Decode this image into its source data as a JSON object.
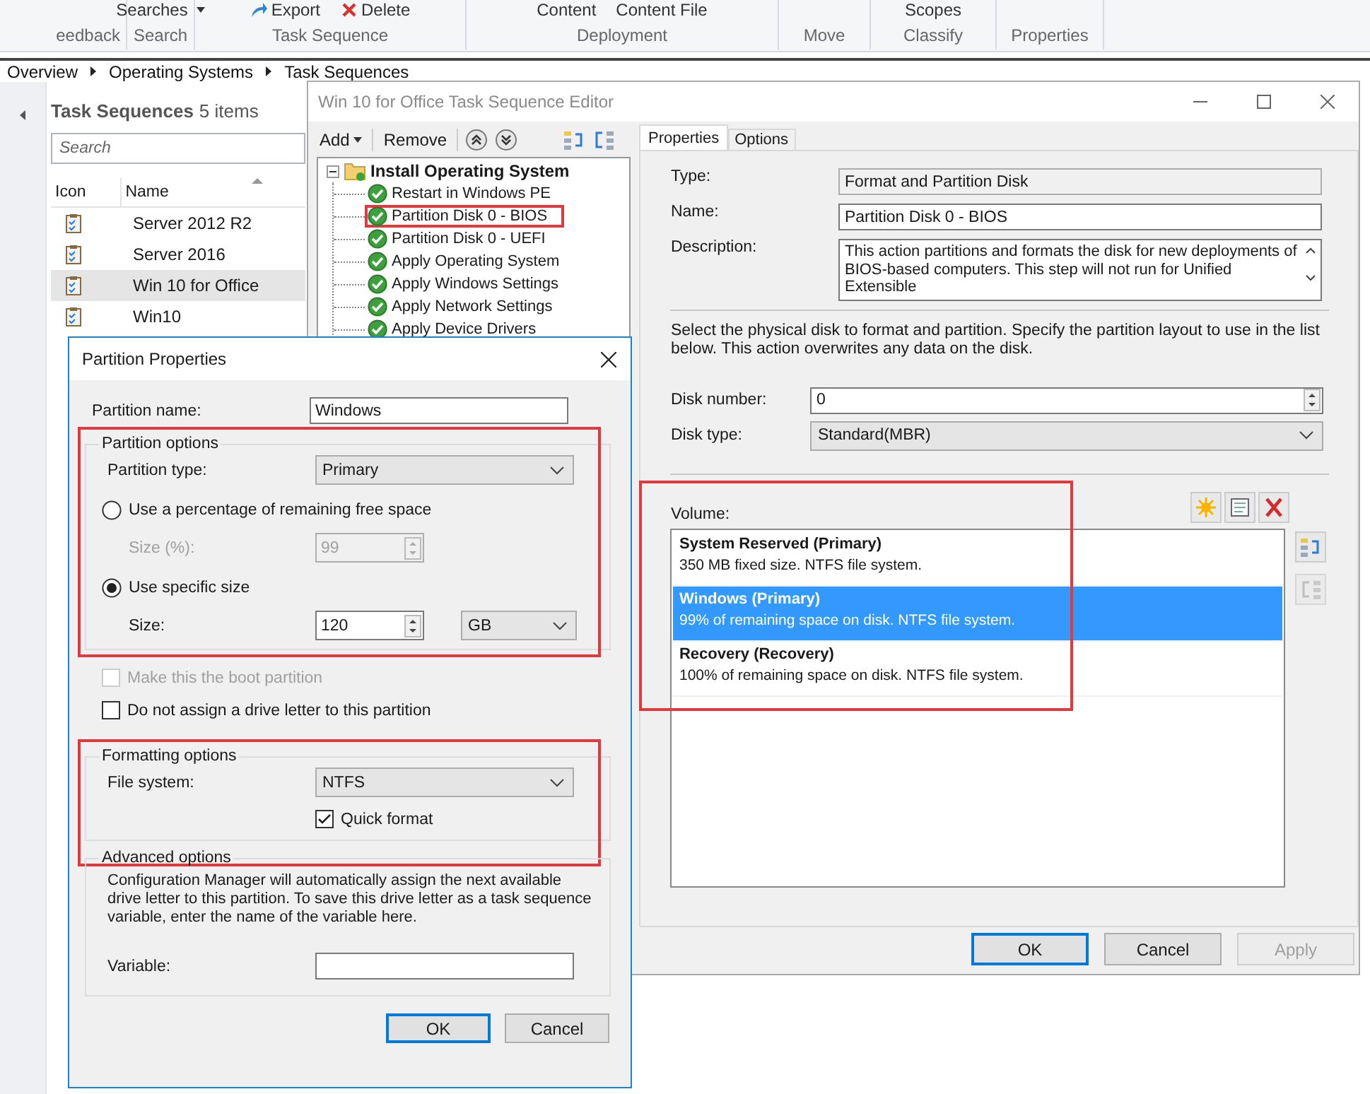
{
  "ribbon": {
    "groups": [
      {
        "label": "eedback"
      },
      {
        "label": "Search",
        "items": [
          {
            "label": "Searches",
            "kind": "dropdown"
          }
        ]
      },
      {
        "label": "Task Sequence",
        "items": [
          {
            "label": "Export",
            "kind": "export"
          },
          {
            "label": "Delete",
            "kind": "delete"
          }
        ]
      },
      {
        "label": "Deployment",
        "items": [
          {
            "label": "Content",
            "kind": "plain"
          },
          {
            "label": "Content File",
            "kind": "plain"
          }
        ]
      },
      {
        "label": "Move"
      },
      {
        "label": "Classify",
        "items": [
          {
            "label": "Scopes",
            "kind": "plain"
          }
        ]
      },
      {
        "label": "Properties"
      }
    ]
  },
  "breadcrumb": [
    "Overview",
    "Operating Systems",
    "Task Sequences"
  ],
  "console": {
    "title": "Task Sequences",
    "count": "5 items",
    "search": {
      "placeholder": "Search"
    },
    "columns": [
      {
        "label": "Icon"
      },
      {
        "label": "Name",
        "sorted": true
      }
    ],
    "rows": [
      {
        "name": "Server 2012 R2",
        "selected": false
      },
      {
        "name": "Server 2016",
        "selected": false
      },
      {
        "name": "Win 10 for Office",
        "selected": true
      },
      {
        "name": "Win10",
        "selected": false
      }
    ]
  },
  "editor": {
    "title": "Win 10 for Office Task Sequence Editor",
    "toolbar": [
      {
        "label": "Add",
        "kind": "dropdown"
      },
      {
        "label": "Remove",
        "kind": "plain"
      }
    ],
    "tree": {
      "label": "Install Operating System",
      "expanded": true,
      "children": [
        {
          "label": "Restart in Windows PE",
          "annotated": false
        },
        {
          "label": "Partition Disk 0 - BIOS",
          "annotated": true
        },
        {
          "label": "Partition Disk 0 - UEFI",
          "annotated": false
        },
        {
          "label": "Apply Operating System",
          "annotated": false
        },
        {
          "label": "Apply Windows Settings",
          "annotated": false
        },
        {
          "label": "Apply Network Settings",
          "annotated": false
        },
        {
          "label": "Apply Device Drivers",
          "annotated": false
        }
      ]
    },
    "tabs": [
      {
        "label": "Properties",
        "selected": true
      },
      {
        "label": "Options",
        "selected": false
      }
    ],
    "fields": [
      {
        "label": "Type:",
        "value": "Format and Partition Disk",
        "kind": "readonly"
      },
      {
        "label": "Name:",
        "value": "Partition Disk 0 - BIOS",
        "kind": "text"
      },
      {
        "label": "Description:",
        "value": "This action partitions and formats the disk for new deployments of BIOS-based computers. This step will not run for Unified Extensible",
        "kind": "multiline"
      }
    ],
    "instructions": "Select the physical disk to format and partition. Specify the partition layout to use in the list below. This action overwrites any data on the disk.",
    "disk_fields": [
      {
        "label": "Disk number:",
        "value": "0",
        "kind": "spin"
      },
      {
        "label": "Disk type:",
        "value": "Standard(MBR)",
        "kind": "dropdown"
      }
    ],
    "volume_label": "Volume:",
    "volumes_annotated": true,
    "volumes": [
      {
        "title": "System Reserved (Primary)",
        "detail": "350 MB fixed size. NTFS file system.",
        "selected": false
      },
      {
        "title": "Windows (Primary)",
        "detail": "99% of remaining space on disk. NTFS file system.",
        "selected": true
      },
      {
        "title": "Recovery (Recovery)",
        "detail": "100% of remaining space on disk. NTFS file system.",
        "selected": false
      }
    ],
    "buttons": [
      {
        "label": "OK",
        "default": true,
        "disabled": false
      },
      {
        "label": "Cancel",
        "default": false,
        "disabled": false
      },
      {
        "label": "Apply",
        "default": false,
        "disabled": true
      }
    ]
  },
  "dialog": {
    "title": "Partition Properties",
    "name_field": {
      "label": "Partition name:",
      "value": "Windows"
    },
    "partition_options": {
      "legend": "Partition options",
      "annotated": true,
      "type_field": {
        "label": "Partition type:",
        "value": "Primary"
      },
      "options": [
        {
          "label": "Use a percentage of remaining free space",
          "selected": false,
          "field": {
            "label": "Size (%):",
            "value": "99",
            "disabled": true
          }
        },
        {
          "label": "Use specific size",
          "selected": true,
          "field": {
            "label": "Size:",
            "value": "120",
            "unit": "GB",
            "disabled": false
          }
        }
      ]
    },
    "checkboxes": [
      {
        "label": "Make this the boot partition",
        "checked": false,
        "disabled": true
      },
      {
        "label": "Do not assign a drive letter to this partition",
        "checked": false,
        "disabled": false
      }
    ],
    "formatting": {
      "legend": "Formatting options",
      "annotated": true,
      "file_system": {
        "label": "File system:",
        "value": "NTFS"
      },
      "quick_format": {
        "label": "Quick format",
        "checked": true
      }
    },
    "advanced": {
      "legend": "Advanced options",
      "text": "Configuration Manager will automatically assign the next available drive letter to this partition. To save this drive letter as a task sequence variable, enter the name of the variable here.",
      "variable_label": "Variable:"
    },
    "buttons": [
      {
        "label": "OK",
        "default": true
      },
      {
        "label": "Cancel",
        "default": false
      }
    ]
  }
}
